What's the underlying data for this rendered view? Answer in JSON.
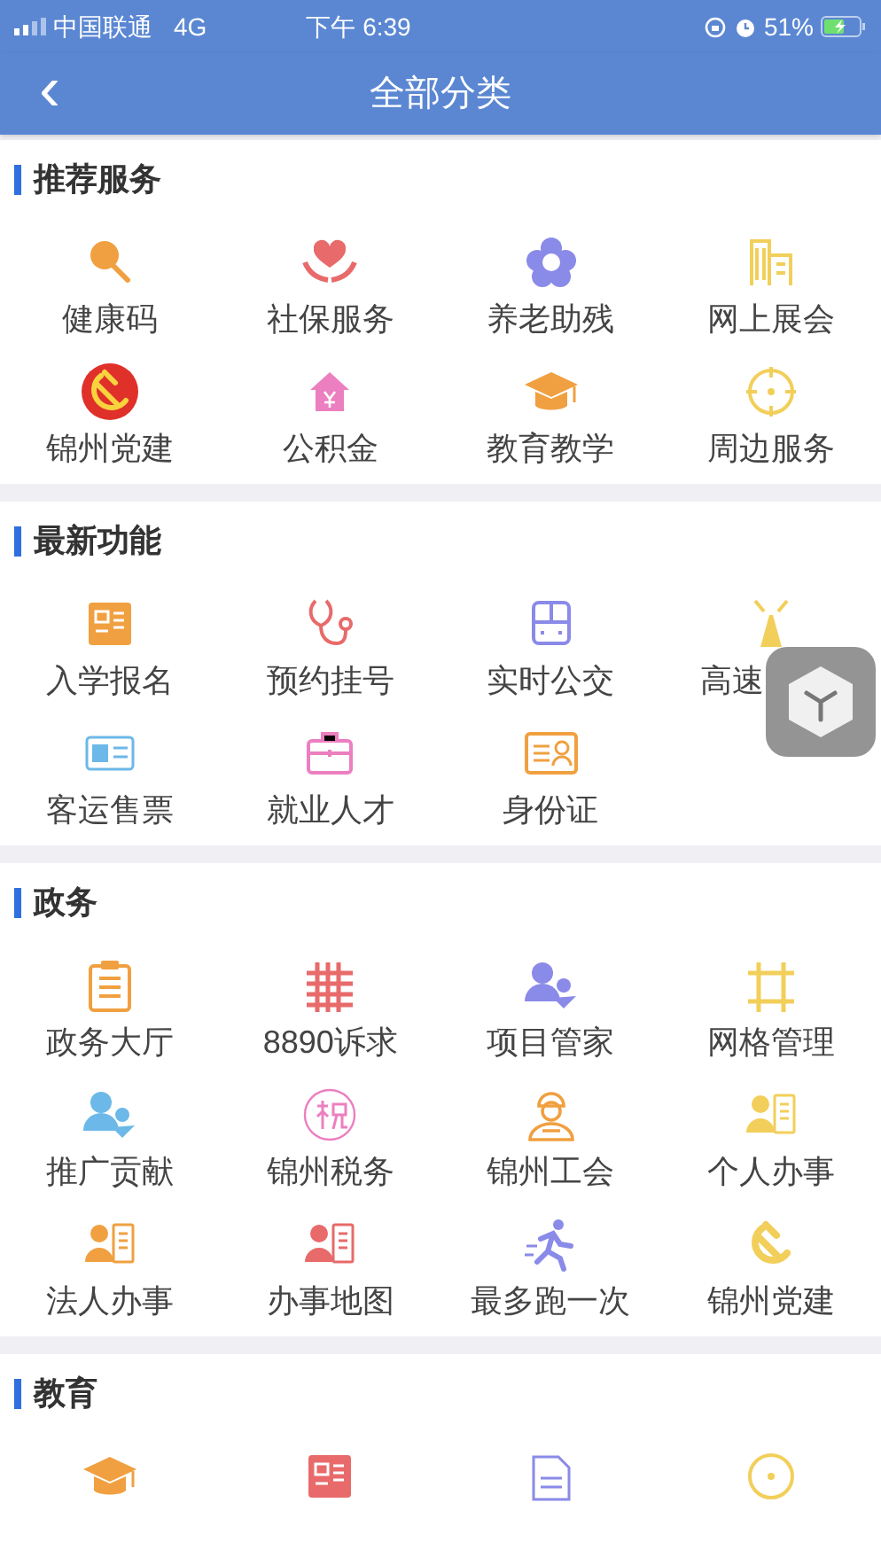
{
  "status_bar": {
    "carrier": "中国联通",
    "network": "4G",
    "time": "下午 6:39",
    "battery": "51%"
  },
  "nav": {
    "back": "‹",
    "title": "全部分类"
  },
  "sections": [
    {
      "title": "推荐服务",
      "items": [
        {
          "label": "健康码"
        },
        {
          "label": "社保服务"
        },
        {
          "label": "养老助残"
        },
        {
          "label": "网上展会"
        },
        {
          "label": "锦州党建"
        },
        {
          "label": "公积金"
        },
        {
          "label": "教育教学"
        },
        {
          "label": "周边服务"
        }
      ]
    },
    {
      "title": "最新功能",
      "items": [
        {
          "label": "入学报名"
        },
        {
          "label": "预约挂号"
        },
        {
          "label": "实时公交"
        },
        {
          "label": "高速"
        },
        {
          "label": "客运售票"
        },
        {
          "label": "就业人才"
        },
        {
          "label": "身份证"
        }
      ]
    },
    {
      "title": "政务",
      "items": [
        {
          "label": "政务大厅"
        },
        {
          "label": "8890诉求"
        },
        {
          "label": "项目管家"
        },
        {
          "label": "网格管理"
        },
        {
          "label": "推广贡献"
        },
        {
          "label": "锦州税务"
        },
        {
          "label": "锦州工会"
        },
        {
          "label": "个人办事"
        },
        {
          "label": "法人办事"
        },
        {
          "label": "办事地图"
        },
        {
          "label": "最多跑一次"
        },
        {
          "label": "锦州党建"
        }
      ]
    },
    {
      "title": "教育",
      "items": [
        {
          "icon_only": true
        },
        {
          "icon_only": true
        },
        {
          "icon_only": true
        },
        {
          "icon_only": true
        }
      ]
    }
  ]
}
